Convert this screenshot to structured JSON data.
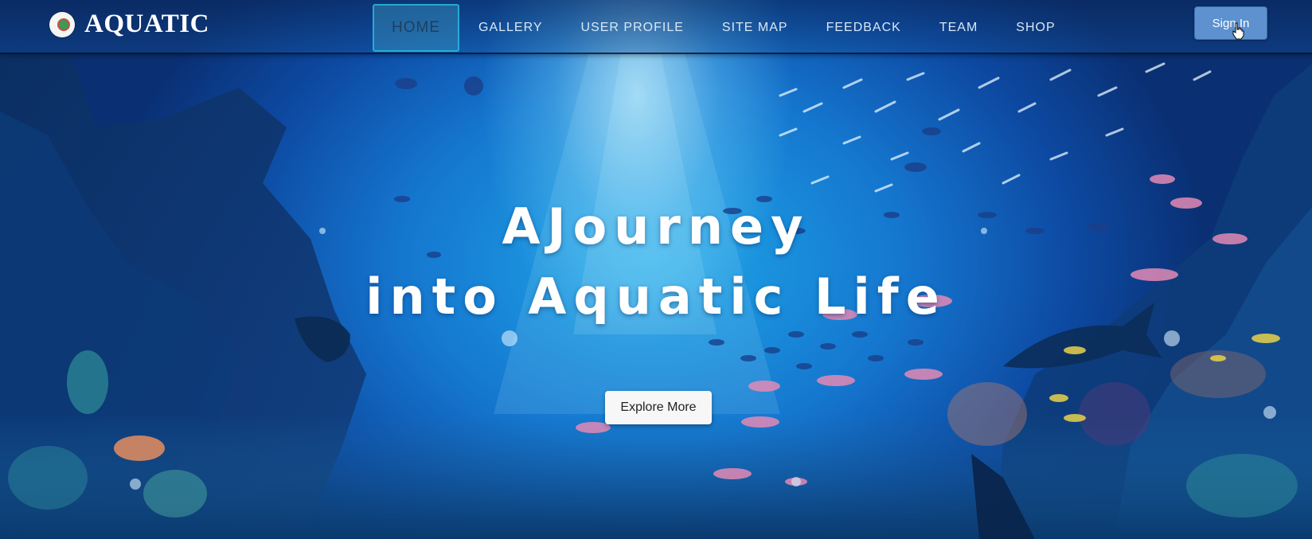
{
  "brand": {
    "name": "AQUATIC",
    "logo_icon": "aquatic-logo-icon"
  },
  "nav": {
    "items": [
      {
        "label": "HOME",
        "active": true
      },
      {
        "label": "GALLERY",
        "active": false
      },
      {
        "label": "USER PROFILE",
        "active": false
      },
      {
        "label": "SITE MAP",
        "active": false
      },
      {
        "label": "FEEDBACK",
        "active": false
      },
      {
        "label": "TEAM",
        "active": false
      },
      {
        "label": "SHOP",
        "active": false
      }
    ],
    "signin_label": "Sign In"
  },
  "hero": {
    "line1": "AJourney",
    "line2": "into Aquatic Life",
    "cta_label": "Explore More",
    "background_image": "underwater-reef-scene"
  },
  "colors": {
    "accent": "#5d91cf",
    "active_tab_border": "#28c8e6",
    "hero_text": "#ffffff"
  }
}
